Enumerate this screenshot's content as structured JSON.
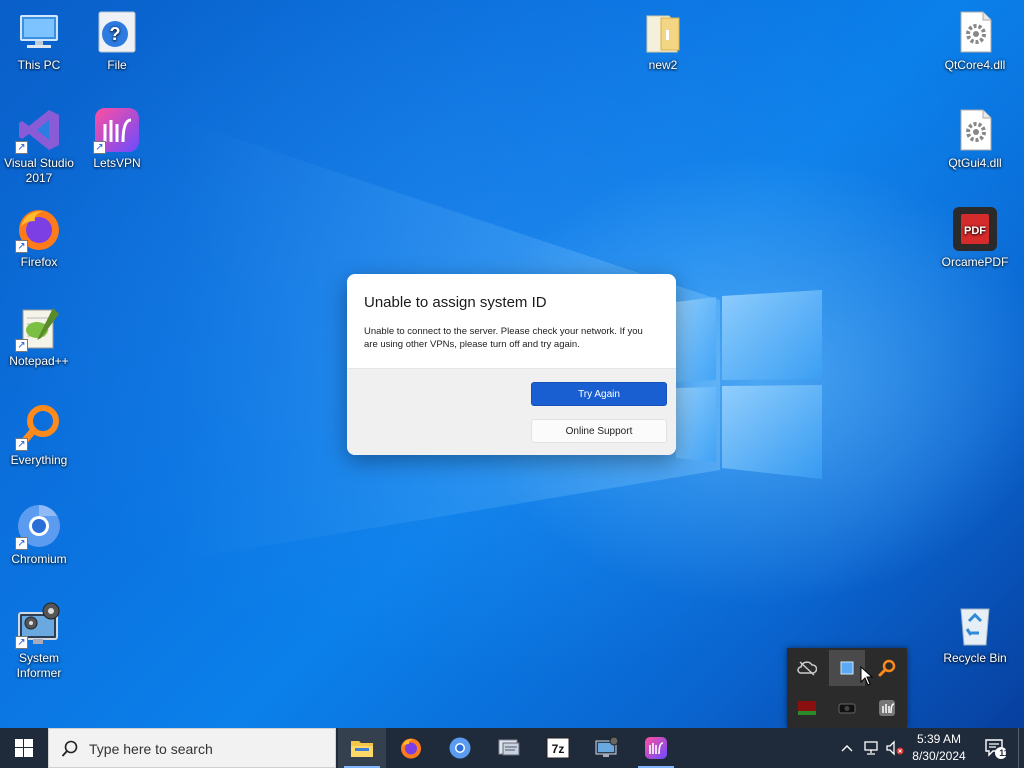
{
  "desktop": {
    "icons": [
      {
        "label": "This PC",
        "icon": "this-pc-icon"
      },
      {
        "label": "File",
        "icon": "help-file-icon"
      },
      {
        "label": "Visual Studio 2017",
        "icon": "visual-studio-icon"
      },
      {
        "label": "LetsVPN",
        "icon": "letsvpn-icon"
      },
      {
        "label": "Firefox",
        "icon": "firefox-icon"
      },
      {
        "label": "Notepad++",
        "icon": "notepad-plus-plus-icon"
      },
      {
        "label": "Everything",
        "icon": "everything-search-icon"
      },
      {
        "label": "Chromium",
        "icon": "chromium-icon"
      },
      {
        "label": "System Informer",
        "icon": "system-informer-icon"
      },
      {
        "label": "new2",
        "icon": "folder-icon"
      },
      {
        "label": "QtCore4.dll",
        "icon": "dll-file-icon"
      },
      {
        "label": "QtGui4.dll",
        "icon": "dll-file-icon"
      },
      {
        "label": "OrcamePDF",
        "icon": "pdf-app-icon"
      },
      {
        "label": "Recycle Bin",
        "icon": "recycle-bin-icon"
      }
    ]
  },
  "dialog": {
    "title": "Unable to assign system ID",
    "message": "Unable to connect to the server. Please check your network. If you are using other VPNs, please turn off and try again.",
    "primary_button": "Try Again",
    "secondary_button": "Online Support"
  },
  "taskbar": {
    "search_placeholder": "Type here to search",
    "apps": [
      "File Explorer",
      "Firefox",
      "Chromium",
      "System tool",
      "7-Zip",
      "System Informer",
      "LetsVPN"
    ],
    "clock": {
      "time": "5:39 AM",
      "date": "8/30/2024"
    },
    "notification_count": "11"
  },
  "tray_flyout": {
    "icons": [
      "onedrive-offline-icon",
      "blue-square-app-icon",
      "everything-tray-icon",
      "red-green-app-icon",
      "camera-tray-icon",
      "letsvpn-tray-icon"
    ]
  },
  "colors": {
    "accent": "#1a5fd1",
    "taskbar": "#1f2b3a",
    "wallpaper": "#0b73e0"
  }
}
